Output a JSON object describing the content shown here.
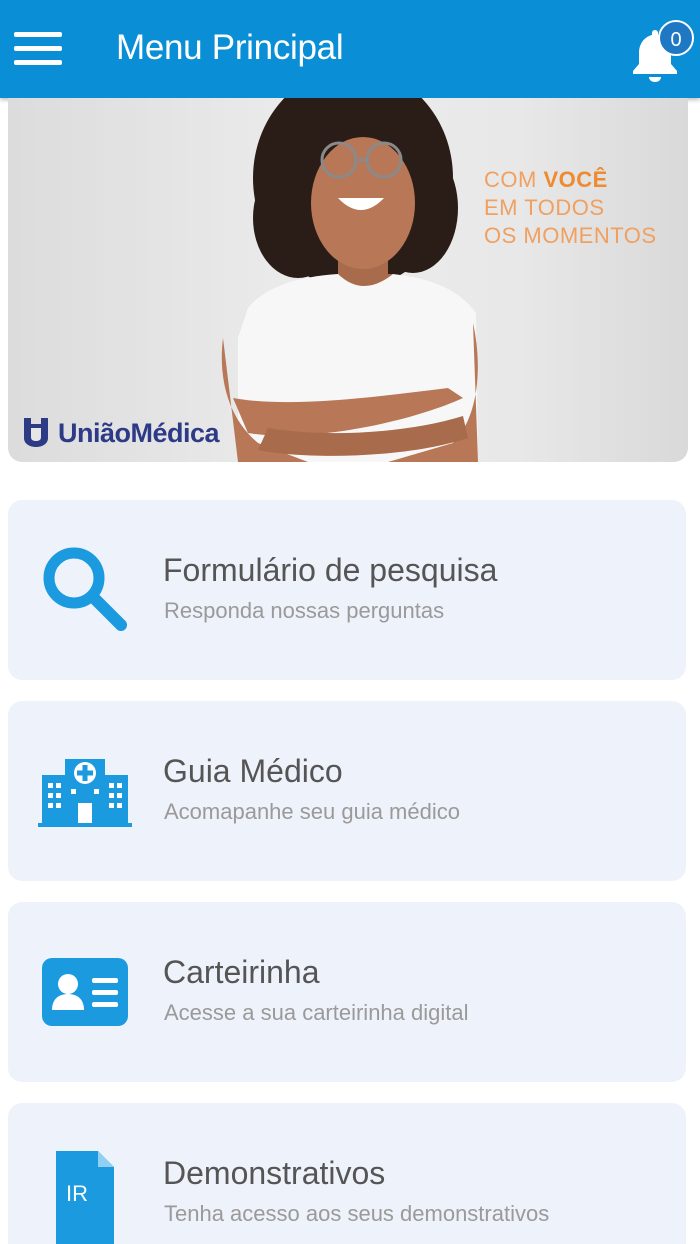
{
  "appbar": {
    "title": "Menu Principal",
    "menu_icon": "hamburger-menu-icon",
    "notifications_icon": "bell-icon",
    "notification_count": "0",
    "background": "#0a8fd6"
  },
  "banner": {
    "slogan_line1_prefix": "COM ",
    "slogan_line1_bold": "VOCÊ",
    "slogan_line2": "EM TODOS",
    "slogan_line3": "OS MOMENTOS",
    "logo_text": "UniãoMédica",
    "accent_color": "#ee8a2f"
  },
  "menu": {
    "items": [
      {
        "title": "Formulário de pesquisa",
        "subtitle": "Responda nossas perguntas",
        "icon": "search-icon"
      },
      {
        "title": "Guia Médico",
        "subtitle": "Acomapanhe seu guia médico",
        "icon": "hospital-icon"
      },
      {
        "title": "Carteirinha",
        "subtitle": "Acesse a sua carteirinha digital",
        "icon": "id-card-icon"
      },
      {
        "title": "Demonstrativos",
        "subtitle": "Tenha acesso aos seus demonstrativos",
        "icon": "ir-document-icon",
        "icon_label": "IR"
      }
    ]
  },
  "colors": {
    "icon_blue": "#1b9ae0",
    "card_bg": "#eef2fa"
  }
}
